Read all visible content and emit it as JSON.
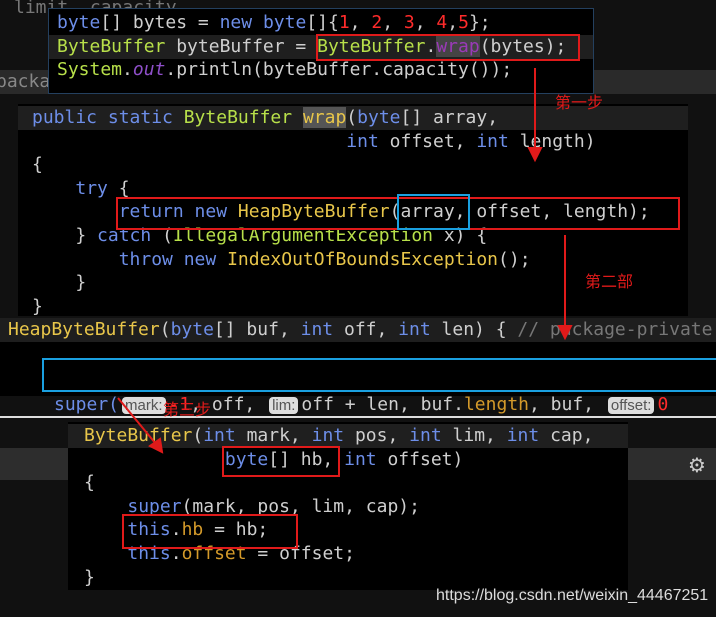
{
  "background_text": {
    "top": "limit  capacity",
    "strip": "packa"
  },
  "panel1": [
    [
      [
        "byte",
        "kw"
      ],
      [
        "[] bytes = ",
        ""
      ],
      [
        "new ",
        "kw"
      ],
      [
        "byte",
        "kw"
      ],
      [
        "[]{",
        ""
      ],
      [
        "1",
        "num"
      ],
      [
        ", ",
        ""
      ],
      [
        "2",
        "num"
      ],
      [
        ", ",
        ""
      ],
      [
        "3",
        "num"
      ],
      [
        ", ",
        ""
      ],
      [
        "4",
        "num"
      ],
      [
        ",",
        ""
      ],
      [
        "5",
        "num"
      ],
      [
        "};",
        ""
      ]
    ],
    [
      [
        "ByteBuffer ",
        "cls"
      ],
      [
        "byteBuffer = ",
        ""
      ],
      [
        "ByteBuffer",
        "cls"
      ],
      [
        ".",
        ""
      ],
      [
        "wrap",
        "wrap"
      ],
      [
        "(bytes);",
        ""
      ]
    ],
    [
      [
        "System",
        "cls"
      ],
      [
        ".",
        ""
      ],
      [
        "out",
        "out"
      ],
      [
        ".println(byteBuffer.capacity());",
        ""
      ]
    ]
  ],
  "panel2": [
    [
      [
        "public static ",
        "kw"
      ],
      [
        "ByteBuffer ",
        "cls"
      ],
      [
        "wrap",
        "wrapsel"
      ],
      [
        "(",
        ""
      ],
      [
        "byte",
        "kw"
      ],
      [
        "[] array,",
        ""
      ]
    ],
    [
      [
        "                             ",
        ""
      ],
      [
        "int ",
        "kw"
      ],
      [
        "offset, ",
        ""
      ],
      [
        "int ",
        "kw"
      ],
      [
        "length)",
        ""
      ]
    ],
    [
      [
        "{",
        ""
      ]
    ],
    [
      [
        "    ",
        ""
      ],
      [
        "try ",
        "kw"
      ],
      [
        "{",
        ""
      ]
    ],
    [
      [
        "        ",
        ""
      ],
      [
        "return new ",
        "kw"
      ],
      [
        "HeapByteBuffer",
        "cls2"
      ],
      [
        "(array, offset, length);",
        ""
      ]
    ],
    [
      [
        "    } ",
        ""
      ],
      [
        "catch ",
        "kw"
      ],
      [
        "(",
        ""
      ],
      [
        "IllegalArgumentException ",
        "cls"
      ],
      [
        "x) {",
        ""
      ]
    ],
    [
      [
        "        ",
        ""
      ],
      [
        "throw new ",
        "kw"
      ],
      [
        "IndexOutOfBoundsException",
        "cls2"
      ],
      [
        "();",
        ""
      ]
    ],
    [
      [
        "    }",
        ""
      ]
    ],
    [
      [
        "}",
        ""
      ]
    ]
  ],
  "strip3": [
    [
      "HeapByteBuffer",
      "cls2"
    ],
    [
      "(",
      ""
    ],
    [
      "byte",
      "kw"
    ],
    [
      "[] buf, ",
      ""
    ],
    [
      "int ",
      "kw"
    ],
    [
      "off, ",
      ""
    ],
    [
      "int ",
      "kw"
    ],
    [
      "len) { ",
      ""
    ],
    [
      "// package-private",
      "cm"
    ]
  ],
  "super_line": {
    "prefix": "super(",
    "mark_hint": "mark:",
    "mark_val": "-1",
    "a": ", off, ",
    "lim_hint": "lim:",
    "b": "off + len, buf.",
    "length": "length",
    "c": ", buf, ",
    "offset_hint": "offset:",
    "d": "0"
  },
  "panel4": [
    [
      [
        "ByteBuffer",
        "cls2"
      ],
      [
        "(",
        ""
      ],
      [
        "int ",
        "kw"
      ],
      [
        "mark, ",
        ""
      ],
      [
        "int ",
        "kw"
      ],
      [
        "pos, ",
        ""
      ],
      [
        "int ",
        "kw"
      ],
      [
        "lim, ",
        ""
      ],
      [
        "int ",
        "kw"
      ],
      [
        "cap,",
        ""
      ]
    ],
    [
      [
        "             ",
        ""
      ],
      [
        "byte",
        "kw"
      ],
      [
        "[] hb, ",
        ""
      ],
      [
        "int ",
        "kw"
      ],
      [
        "offset)",
        ""
      ]
    ],
    [
      [
        "{",
        ""
      ]
    ],
    [
      [
        "    ",
        ""
      ],
      [
        "super",
        "kw"
      ],
      [
        "(mark, pos, lim, cap);",
        ""
      ]
    ],
    [
      [
        "    ",
        ""
      ],
      [
        "this",
        "kw"
      ],
      [
        ".",
        ""
      ],
      [
        "hb",
        "fld"
      ],
      [
        " = hb;",
        ""
      ]
    ],
    [
      [
        "    ",
        ""
      ],
      [
        "this",
        "kw"
      ],
      [
        ".",
        ""
      ],
      [
        "offset",
        "fld"
      ],
      [
        " = offset;",
        ""
      ]
    ],
    [
      [
        "}",
        ""
      ]
    ]
  ],
  "annotations": {
    "step1": "第一步",
    "step2": "第二部",
    "step3": "第三步"
  },
  "watermark": "https://blog.csdn.net/weixin_44467251",
  "icons": {
    "settings": "gear-icon"
  },
  "colors": {
    "annotation_red": "#e01a1a",
    "highlight_blue": "#1aa0e0"
  }
}
